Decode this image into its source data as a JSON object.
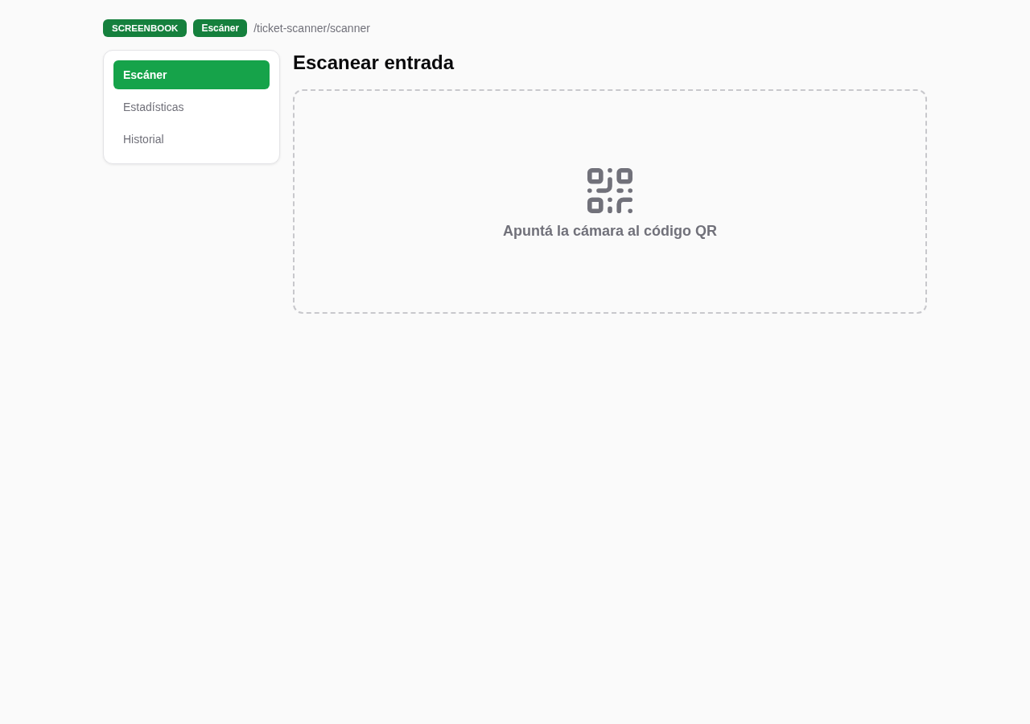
{
  "breadcrumb": {
    "app_badge": "SCREENBOOK",
    "page_badge": "Escáner",
    "path": "/ticket-scanner/scanner"
  },
  "sidebar": {
    "items": [
      {
        "label": "Escáner",
        "selected": true
      },
      {
        "label": "Estadísticas",
        "selected": false
      },
      {
        "label": "Historial",
        "selected": false
      }
    ]
  },
  "main": {
    "title": "Escanear entrada",
    "scanner": {
      "prompt": "Apuntá la cámara al código QR"
    }
  }
}
